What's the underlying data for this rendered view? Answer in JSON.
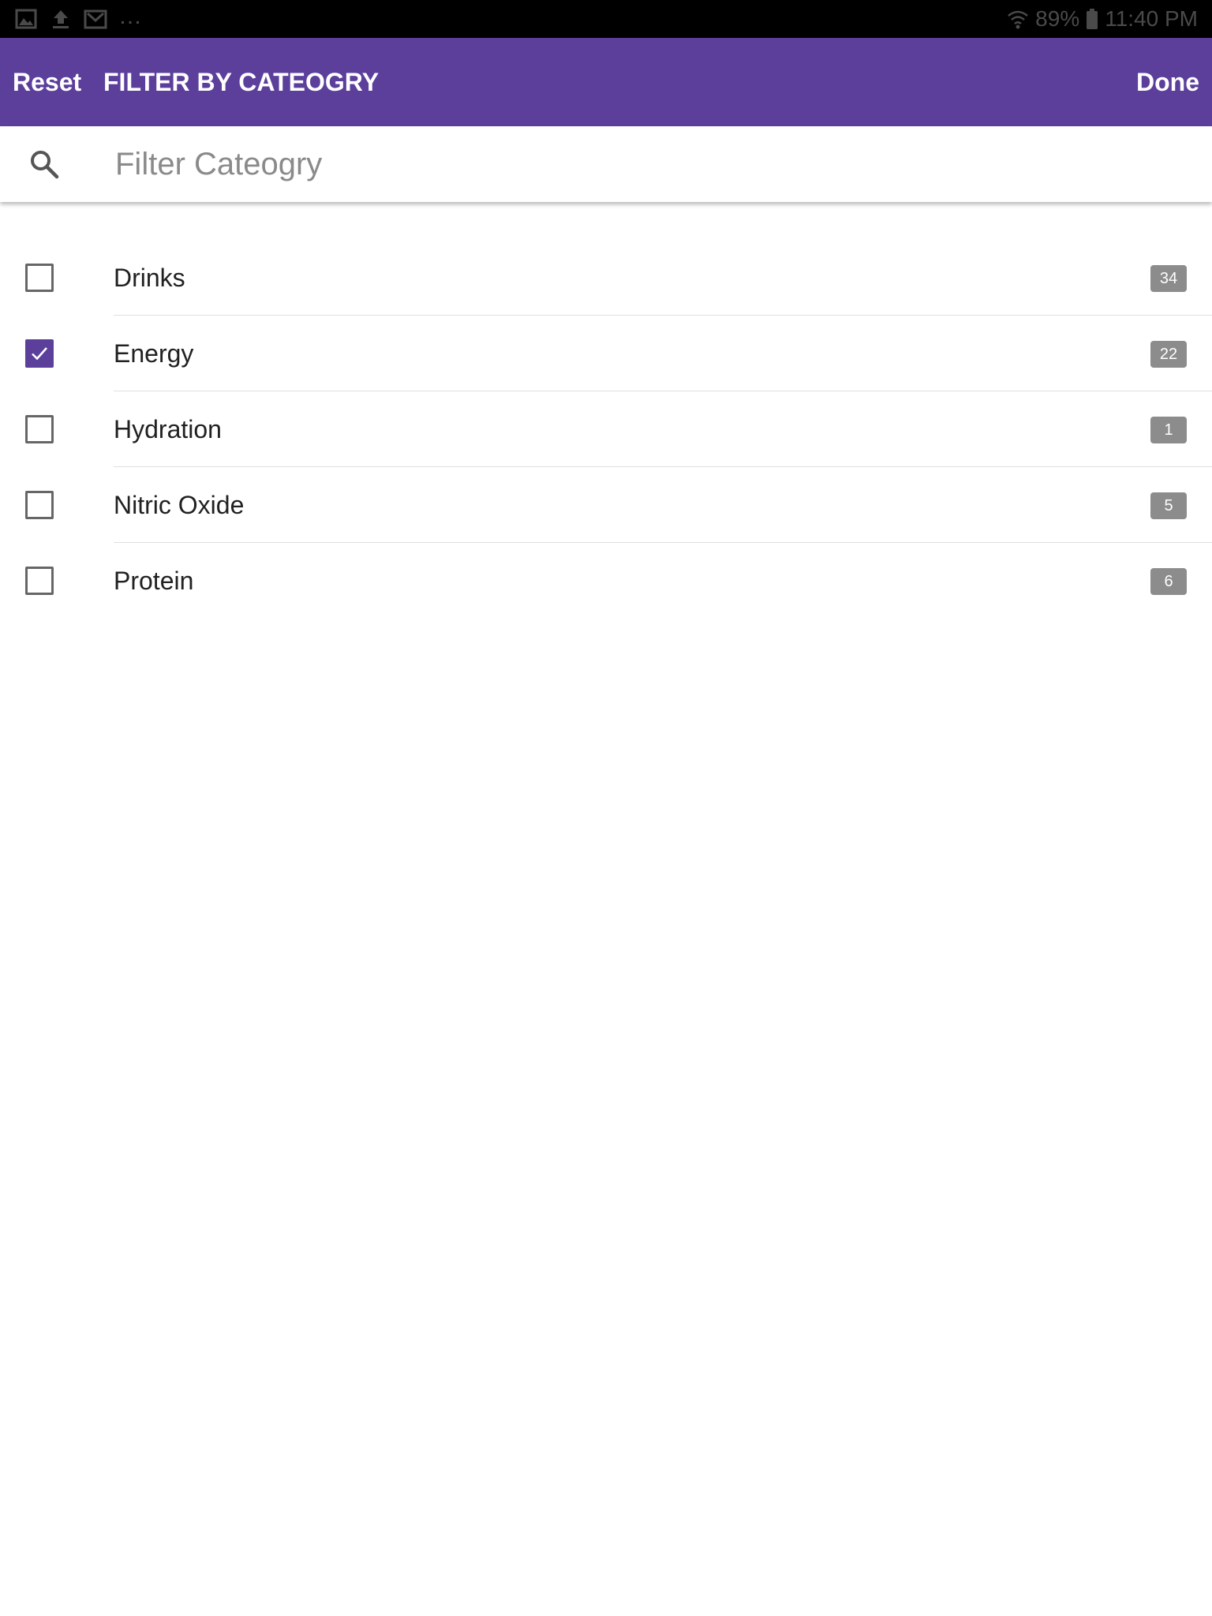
{
  "status_bar": {
    "left_icons": [
      "image-icon",
      "upload-icon",
      "gmail-icon"
    ],
    "more_indicator": "…",
    "battery_percent": "89%",
    "time": "11:40 PM"
  },
  "header": {
    "reset_label": "Reset",
    "title": "FILTER BY CATEOGRY",
    "done_label": "Done"
  },
  "search": {
    "placeholder": "Filter Cateogry",
    "value": ""
  },
  "categories": [
    {
      "label": "Drinks",
      "count": "34",
      "checked": false
    },
    {
      "label": "Energy",
      "count": "22",
      "checked": true
    },
    {
      "label": "Hydration",
      "count": "1",
      "checked": false
    },
    {
      "label": "Nitric Oxide",
      "count": "5",
      "checked": false
    },
    {
      "label": "Protein",
      "count": "6",
      "checked": false
    }
  ],
  "colors": {
    "accent": "#5b3f9b",
    "badge": "#8c8c8c",
    "status_bar": "#000000"
  }
}
